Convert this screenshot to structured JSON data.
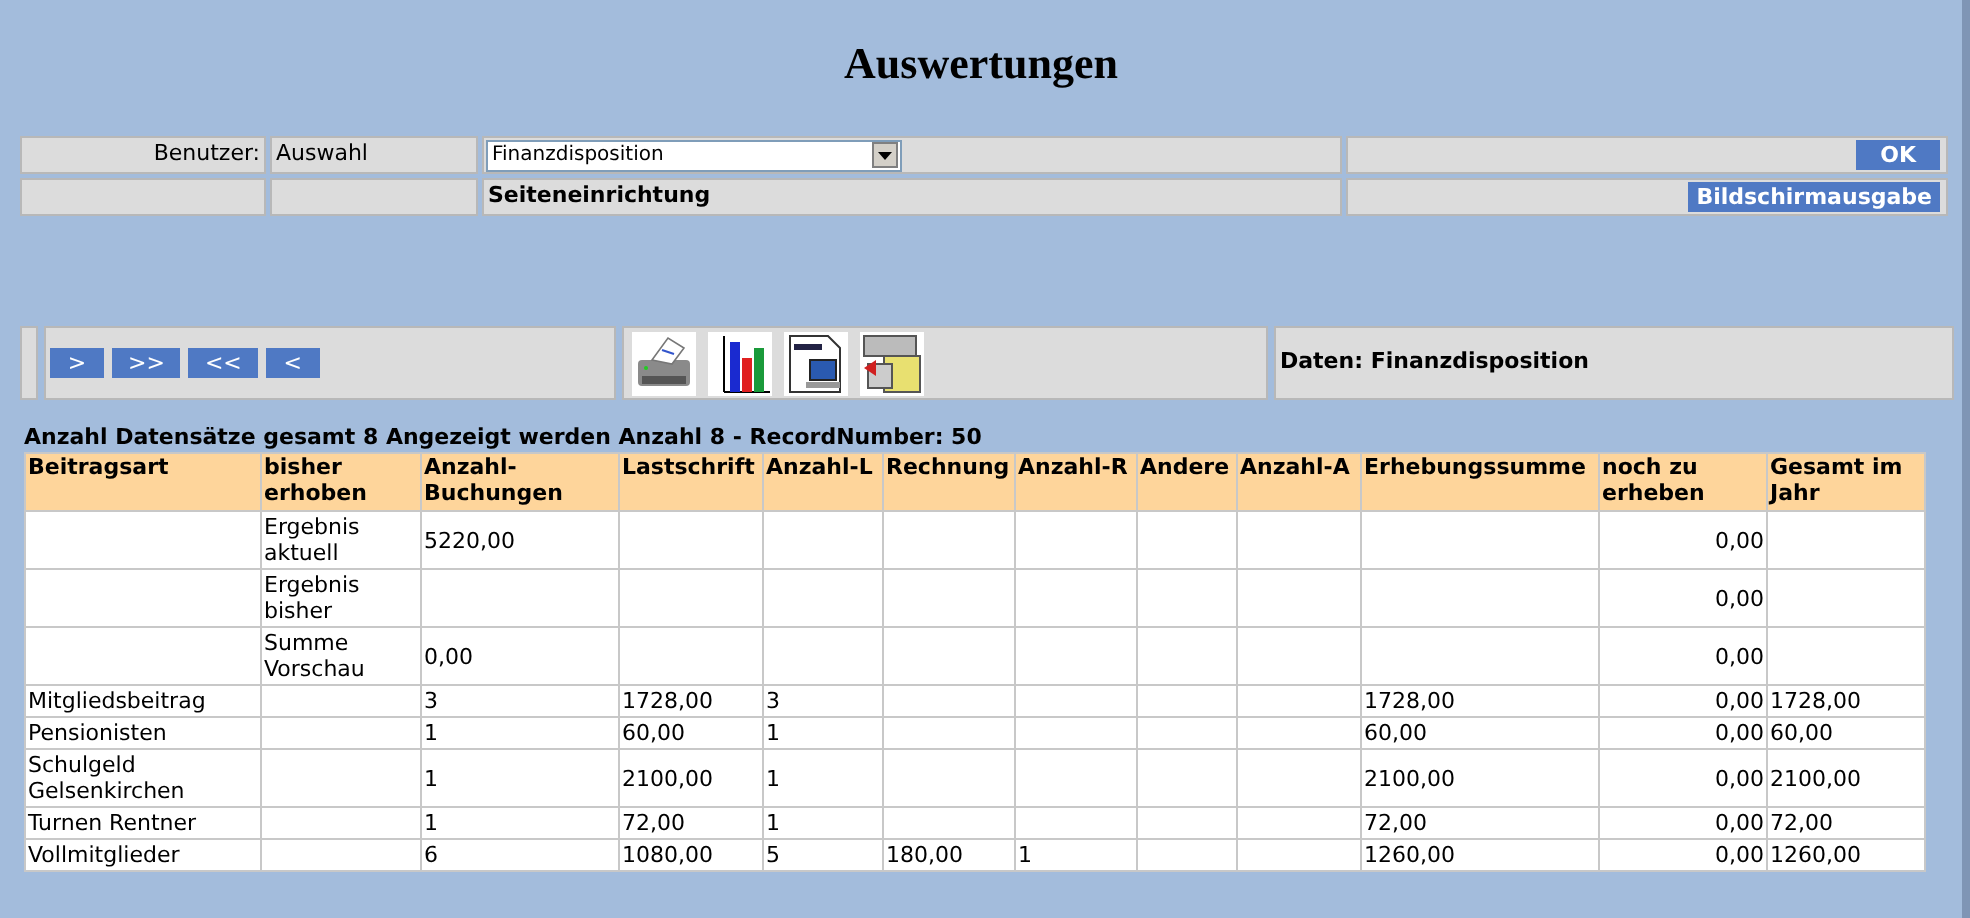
{
  "title": "Auswertungen",
  "form": {
    "user_label": "Benutzer:",
    "user_value": "Auswahl",
    "report_select": {
      "value": "Finanzdisposition"
    },
    "page_setup": "Seiteneinrichtung",
    "ok_button": "OK",
    "output_button": "Bildschirmausgabe"
  },
  "toolbar": {
    "nav_buttons": [
      ">",
      ">>",
      "<<",
      "<"
    ],
    "data_label": "Daten: Finanzdisposition"
  },
  "summary": "Anzahl Datensätze gesamt 8 Angezeigt werden Anzahl 8 - RecordNumber: 50",
  "table": {
    "columns": [
      "Beitragsart",
      "bisher erhoben",
      "Anzahl-Buchungen",
      "Lastschrift",
      "Anzahl-L",
      "Rechnung",
      "Anzahl-R",
      "Andere",
      "Anzahl-A",
      "Erhebungssumme",
      "noch zu erheben",
      "Gesamt im Jahr"
    ],
    "rows": [
      [
        null,
        "Ergebnis aktuell",
        "5220,00",
        null,
        null,
        null,
        null,
        null,
        null,
        null,
        "0,00",
        null
      ],
      [
        null,
        "Ergebnis bisher",
        null,
        null,
        null,
        null,
        null,
        null,
        null,
        null,
        "0,00",
        null
      ],
      [
        null,
        "Summe Vorschau",
        "0,00",
        null,
        null,
        null,
        null,
        null,
        null,
        null,
        "0,00",
        null
      ],
      [
        "Mitgliedsbeitrag",
        null,
        "3",
        "1728,00",
        "3",
        null,
        null,
        null,
        null,
        "1728,00",
        "0,00",
        "1728,00"
      ],
      [
        "Pensionisten",
        null,
        "1",
        "60,00",
        "1",
        null,
        null,
        null,
        null,
        "60,00",
        "0,00",
        "60,00"
      ],
      [
        "Schulgeld Gelsenkirchen",
        null,
        "1",
        "2100,00",
        "1",
        null,
        null,
        null,
        null,
        "2100,00",
        "0,00",
        "2100,00"
      ],
      [
        "Turnen Rentner",
        null,
        "1",
        "72,00",
        "1",
        null,
        null,
        null,
        null,
        "72,00",
        "0,00",
        "72,00"
      ],
      [
        "Vollmitglieder",
        null,
        "6",
        "1080,00",
        "5",
        "180,00",
        "1",
        null,
        null,
        "1260,00",
        "0,00",
        "1260,00"
      ]
    ]
  }
}
